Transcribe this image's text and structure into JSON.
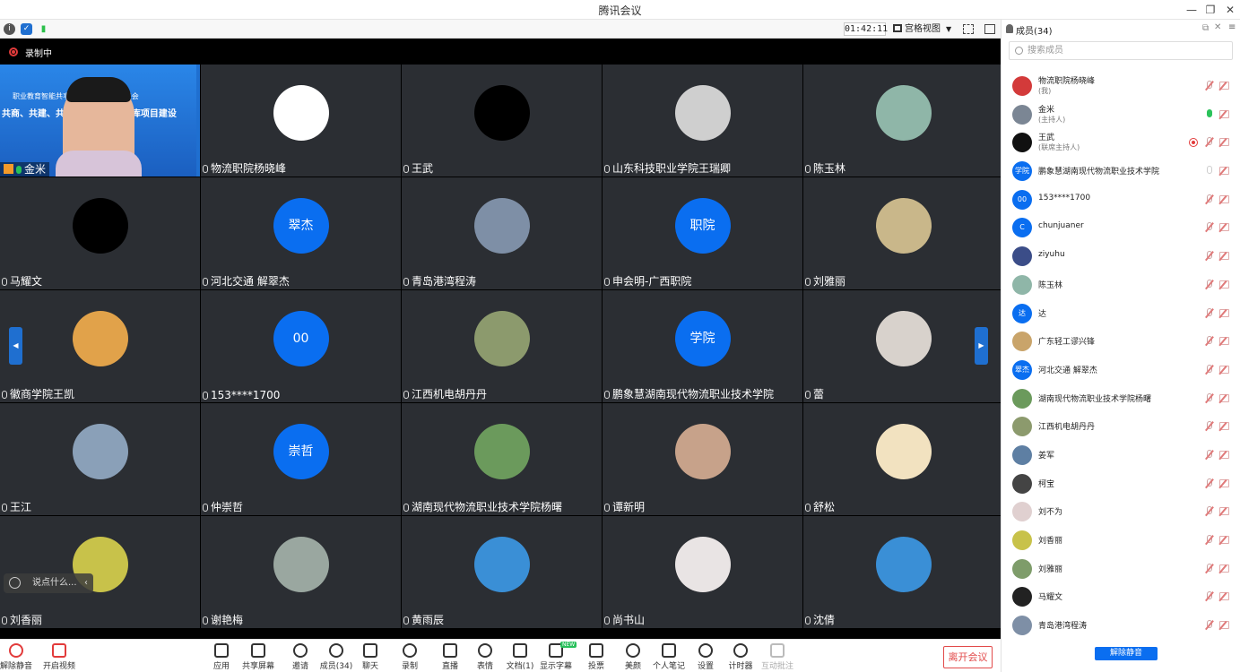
{
  "window": {
    "title": "腾讯会议"
  },
  "infobar": {
    "timer": "01:42:11",
    "view_label": "宫格视图"
  },
  "recording": {
    "label": "录制中"
  },
  "speaker": {
    "name": "金米",
    "banner_line1": "职业教育智能共享平台 ... 库建设推进会",
    "banner_line2": "共商、共建、共享国... 教学资源库项目建设"
  },
  "tiles": [
    {
      "name": "物流职院杨晓峰",
      "avatar": "photo",
      "color": "#ffffff"
    },
    {
      "name": "王武",
      "avatar": "photo",
      "color": "#000000"
    },
    {
      "name": "山东科技职业学院王瑞卿",
      "avatar": "photo",
      "color": "#cfcfcf"
    },
    {
      "name": "陈玉林",
      "avatar": "photo",
      "color": "#8fb6a8"
    },
    {
      "name": "马耀文",
      "avatar": "photo",
      "color": "#000000"
    },
    {
      "name": "河北交通 解翠杰",
      "avatar": "text",
      "text": "翠杰"
    },
    {
      "name": "青岛港湾程涛",
      "avatar": "photo",
      "color": "#7e8fa6"
    },
    {
      "name": "申会明-广西职院",
      "avatar": "text",
      "text": "职院"
    },
    {
      "name": "刘雅丽",
      "avatar": "photo",
      "color": "#c9b78a"
    },
    {
      "name": "徽商学院王凯",
      "avatar": "photo",
      "color": "#e1a24a"
    },
    {
      "name": "153****1700",
      "avatar": "text",
      "text": "00"
    },
    {
      "name": "江西机电胡丹丹",
      "avatar": "photo",
      "color": "#8c9a6d"
    },
    {
      "name": "鹏象慧湖南现代物流职业技术学院",
      "avatar": "text",
      "text": "学院"
    },
    {
      "name": "蕾",
      "avatar": "photo",
      "color": "#d8d2cc"
    },
    {
      "name": "王江",
      "avatar": "photo",
      "color": "#8aa0b8"
    },
    {
      "name": "仲崇哲",
      "avatar": "text",
      "text": "崇哲"
    },
    {
      "name": "湖南现代物流职业技术学院杨曙",
      "avatar": "photo",
      "color": "#6b9a5c"
    },
    {
      "name": "谭新明",
      "avatar": "photo",
      "color": "#c7a28a"
    },
    {
      "name": "舒松",
      "avatar": "photo",
      "color": "#f2e2c0"
    },
    {
      "name": "刘香丽",
      "avatar": "photo",
      "color": "#c8c24a"
    },
    {
      "name": "谢艳梅",
      "avatar": "photo",
      "color": "#9aa7a0"
    },
    {
      "name": "黄雨辰",
      "avatar": "photo",
      "color": "#3a8fd6"
    },
    {
      "name": "尚书山",
      "avatar": "photo",
      "color": "#e9e4e4"
    },
    {
      "name": "沈倩",
      "avatar": "photo",
      "color": "#3a8fd6"
    }
  ],
  "chat": {
    "placeholder": "说点什么..."
  },
  "toolbar": {
    "mute": "解除静音",
    "video": "开启视频",
    "apps": "应用",
    "share": "共享屏幕",
    "invite": "邀请",
    "members": "成员(34)",
    "chat": "聊天",
    "record": "录制",
    "live": "直播",
    "emoji": "表情",
    "docs": "文档(1)",
    "subtitles": "显示字幕",
    "vote": "投票",
    "beauty": "美颜",
    "notes": "个人笔记",
    "settings": "设置",
    "timer": "计时器",
    "annotate": "互动批注",
    "leave": "离开会议",
    "new_badge": "NEW"
  },
  "panel": {
    "title": "成员(34)",
    "search_placeholder": "搜索成员",
    "unmute_all": "解除静音",
    "members": [
      {
        "name": "物流职院杨晓峰",
        "role": "(我)",
        "avatar": "photo",
        "color": "#d33a3a",
        "mic": "off"
      },
      {
        "name": "金米",
        "role": "(主持人)",
        "avatar": "photo",
        "color": "#7b8694",
        "mic": "on"
      },
      {
        "name": "王武",
        "role": "(联席主持人)",
        "avatar": "photo",
        "color": "#111111",
        "mic": "off",
        "rec": true
      },
      {
        "name": "鹏象慧湖南现代物流职业技术学院",
        "role": "",
        "avatar": "text",
        "text": "学院",
        "color": "#0a6ef0",
        "mic": "grey"
      },
      {
        "name": "153****1700",
        "role": "",
        "avatar": "text",
        "text": "00",
        "color": "#0a6ef0",
        "mic": "off"
      },
      {
        "name": "chunjuaner",
        "role": "",
        "avatar": "text",
        "text": "C",
        "color": "#0a6ef0",
        "mic": "off"
      },
      {
        "name": "ziyuhu",
        "role": "",
        "avatar": "photo",
        "color": "#3b4d88",
        "mic": "off"
      },
      {
        "name": "陈玉林",
        "role": "",
        "avatar": "photo",
        "color": "#8fb6a8",
        "mic": "off"
      },
      {
        "name": "达",
        "role": "",
        "avatar": "text",
        "text": "达",
        "color": "#0a6ef0",
        "mic": "off"
      },
      {
        "name": "广东轻工谬兴锋",
        "role": "",
        "avatar": "photo",
        "color": "#c9a46a",
        "mic": "off"
      },
      {
        "name": "河北交通 解翠杰",
        "role": "",
        "avatar": "text",
        "text": "翠杰",
        "color": "#0a6ef0",
        "mic": "off"
      },
      {
        "name": "湖南现代物流职业技术学院杨曙",
        "role": "",
        "avatar": "photo",
        "color": "#6b9a5c",
        "mic": "off"
      },
      {
        "name": "江西机电胡丹丹",
        "role": "",
        "avatar": "photo",
        "color": "#8c9a6d",
        "mic": "off"
      },
      {
        "name": "姜军",
        "role": "",
        "avatar": "photo",
        "color": "#5e7fa3",
        "mic": "off"
      },
      {
        "name": "柯宝",
        "role": "",
        "avatar": "photo",
        "color": "#444444",
        "mic": "off"
      },
      {
        "name": "刘不为",
        "role": "",
        "avatar": "photo",
        "color": "#e0d0d0",
        "mic": "off"
      },
      {
        "name": "刘香丽",
        "role": "",
        "avatar": "photo",
        "color": "#c8c24a",
        "mic": "off"
      },
      {
        "name": "刘雅丽",
        "role": "",
        "avatar": "photo",
        "color": "#7e9c6a",
        "mic": "off"
      },
      {
        "name": "马耀文",
        "role": "",
        "avatar": "photo",
        "color": "#222222",
        "mic": "off"
      },
      {
        "name": "青岛港湾程涛",
        "role": "",
        "avatar": "photo",
        "color": "#7e8fa6",
        "mic": "off"
      }
    ]
  }
}
